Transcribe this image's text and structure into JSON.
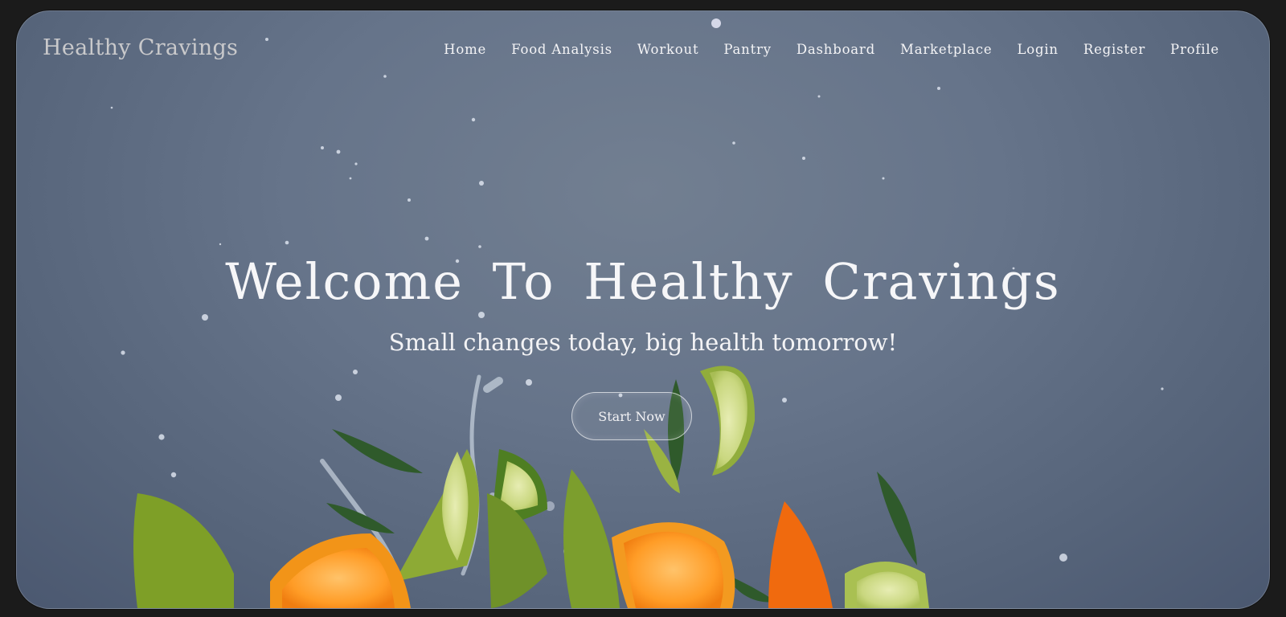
{
  "brand": {
    "name": "Healthy Cravings"
  },
  "nav": {
    "items": [
      {
        "label": "Home"
      },
      {
        "label": "Food Analysis"
      },
      {
        "label": "Workout"
      },
      {
        "label": "Pantry"
      },
      {
        "label": "Dashboard"
      },
      {
        "label": "Marketplace"
      },
      {
        "label": "Login"
      },
      {
        "label": "Register"
      },
      {
        "label": "Profile"
      }
    ]
  },
  "hero": {
    "title": "Welcome To Healthy Cravings",
    "subtitle": "Small changes today, big health tomorrow!",
    "cta_label": "Start Now"
  },
  "colors": {
    "page_bg": "#1b1b1b",
    "hero_bg": "#66748a",
    "text": "#f4f4f6",
    "logo_text": "#c9c9cb",
    "lime": "#9bb63a",
    "orange": "#f28a14"
  },
  "icons": {
    "background": "fruit-splash-background"
  }
}
